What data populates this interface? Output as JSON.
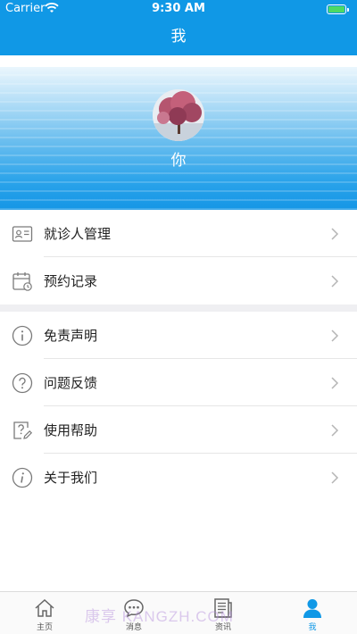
{
  "status_bar": {
    "carrier": "Carrier",
    "time": "9:30 AM"
  },
  "nav": {
    "title": "我"
  },
  "profile": {
    "name": "你"
  },
  "group1": [
    {
      "label": "就诊人管理",
      "icon": "id-card-icon"
    },
    {
      "label": "预约记录",
      "icon": "calendar-clock-icon"
    }
  ],
  "group2": [
    {
      "label": "免责声明",
      "icon": "info-icon"
    },
    {
      "label": "问题反馈",
      "icon": "question-icon"
    },
    {
      "label": "使用帮助",
      "icon": "help-edit-icon"
    },
    {
      "label": "关于我们",
      "icon": "info-italic-icon"
    }
  ],
  "tabbar": [
    {
      "label": "主页",
      "icon": "home-icon"
    },
    {
      "label": "消息",
      "icon": "message-icon"
    },
    {
      "label": "资讯",
      "icon": "news-icon"
    },
    {
      "label": "我",
      "icon": "user-icon",
      "active": true
    }
  ],
  "colors": {
    "primary": "#1098e6",
    "divider": "#e6e6e6",
    "icon": "#7a7a7a"
  },
  "watermark": "康享 KANGZH.COM"
}
